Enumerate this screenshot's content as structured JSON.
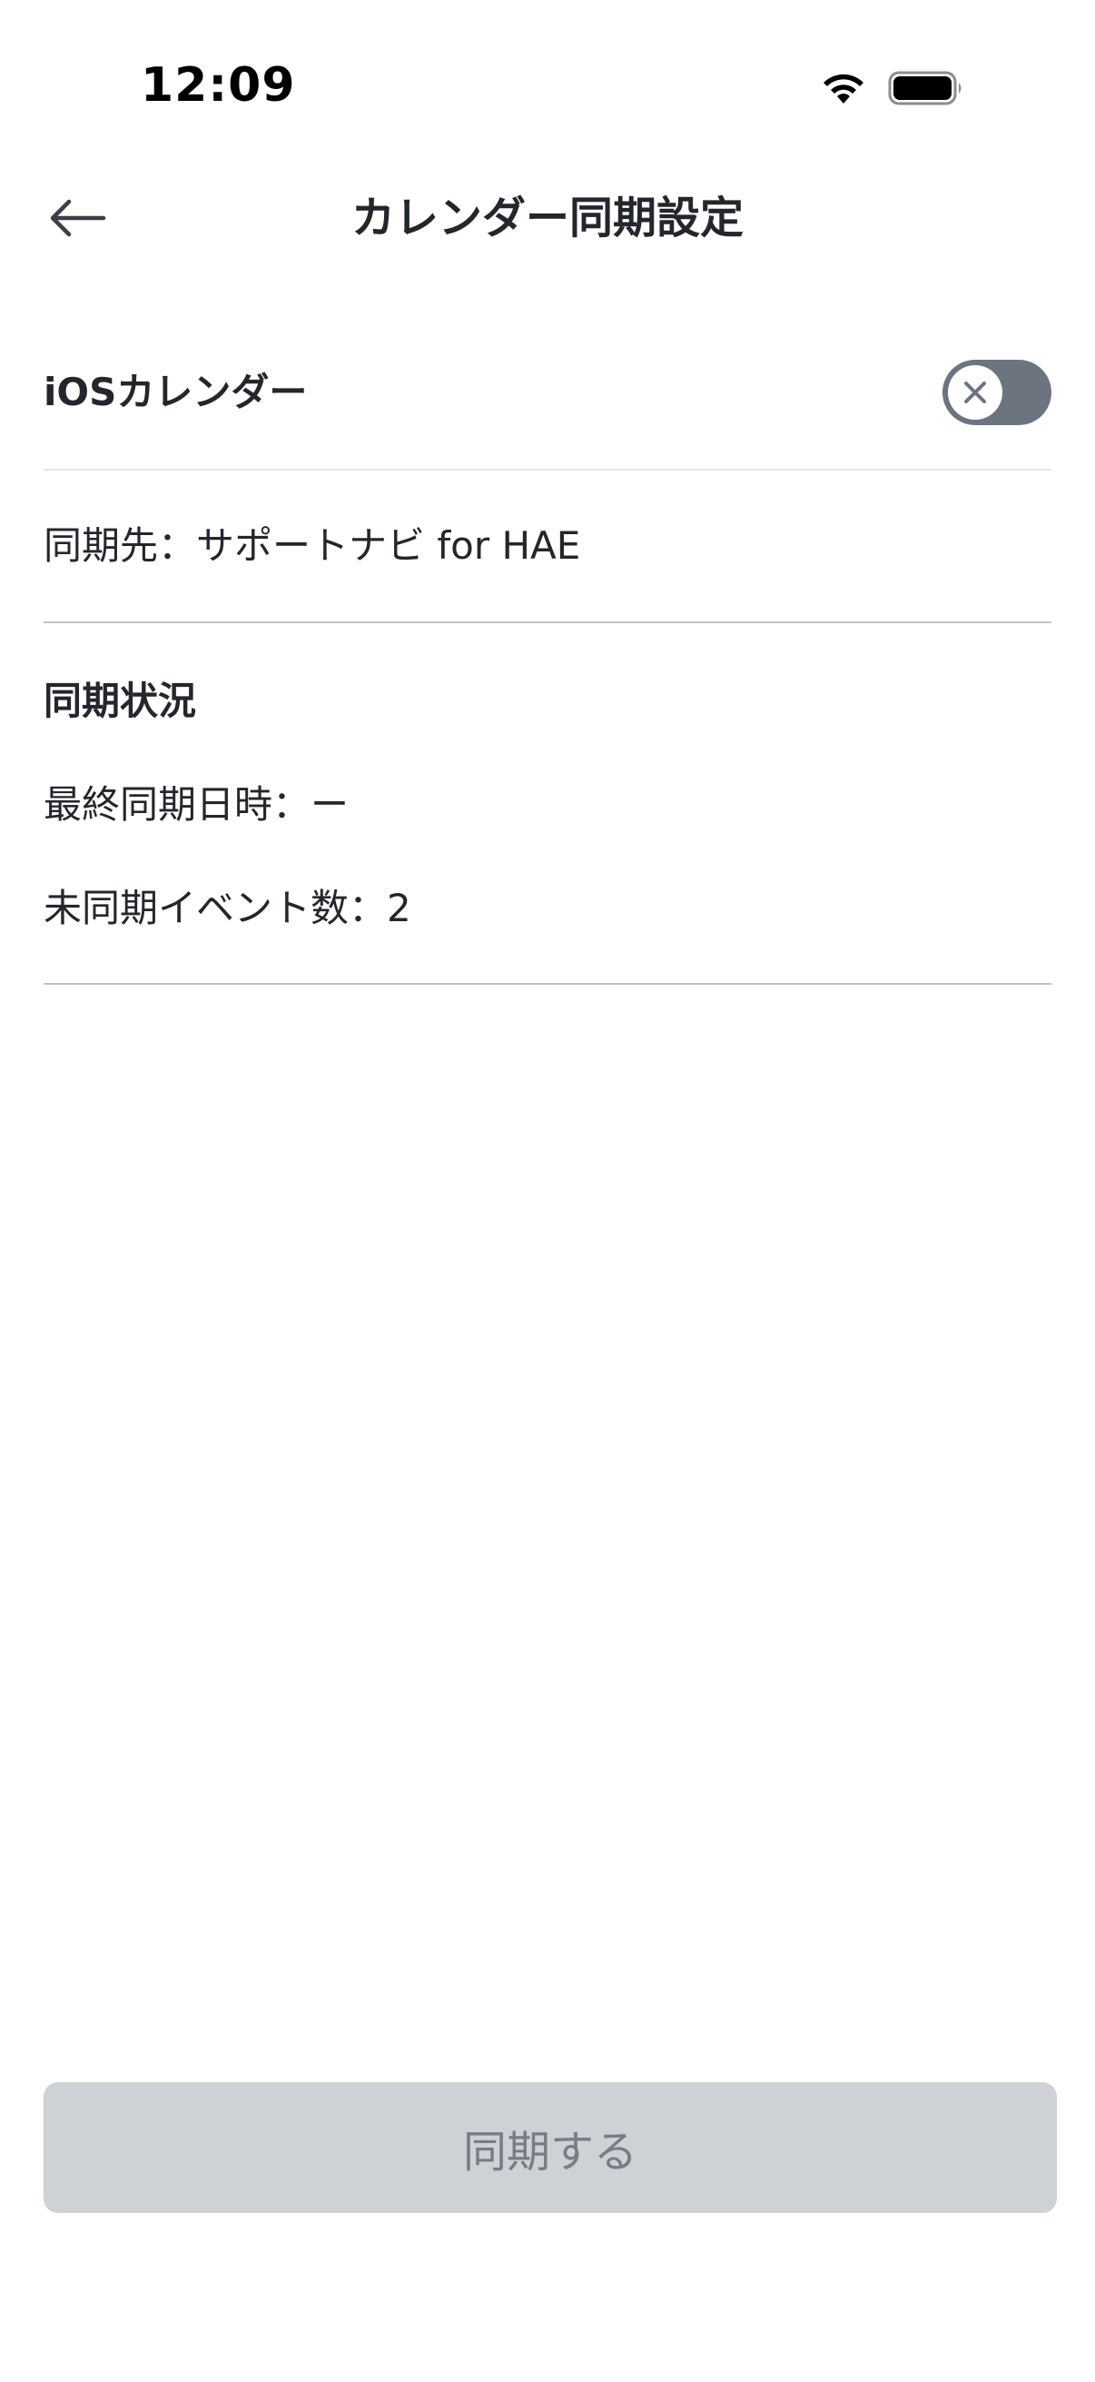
{
  "status_bar": {
    "time": "12:09",
    "icons": [
      "wifi-icon",
      "battery-icon"
    ]
  },
  "header": {
    "title": "カレンダー同期設定",
    "back_icon": "arrow-left-icon"
  },
  "ios_calendar": {
    "label": "iOSカレンダー",
    "toggle_state": "off",
    "toggle_icon": "close-icon"
  },
  "sync_target": {
    "text": "同期先：サポートナビ for HAE"
  },
  "sync_status": {
    "heading": "同期状況",
    "last_sync": "最終同期日時：ー",
    "unsynced_events": "未同期イベント数：2"
  },
  "sync_button": {
    "label": "同期する",
    "enabled": false
  },
  "colors": {
    "text": "#23272d",
    "toggle_off_track": "#6c757f",
    "button_disabled_bg": "#ced1d5",
    "button_disabled_text": "#767d86",
    "divider": "#bfc2c6"
  }
}
